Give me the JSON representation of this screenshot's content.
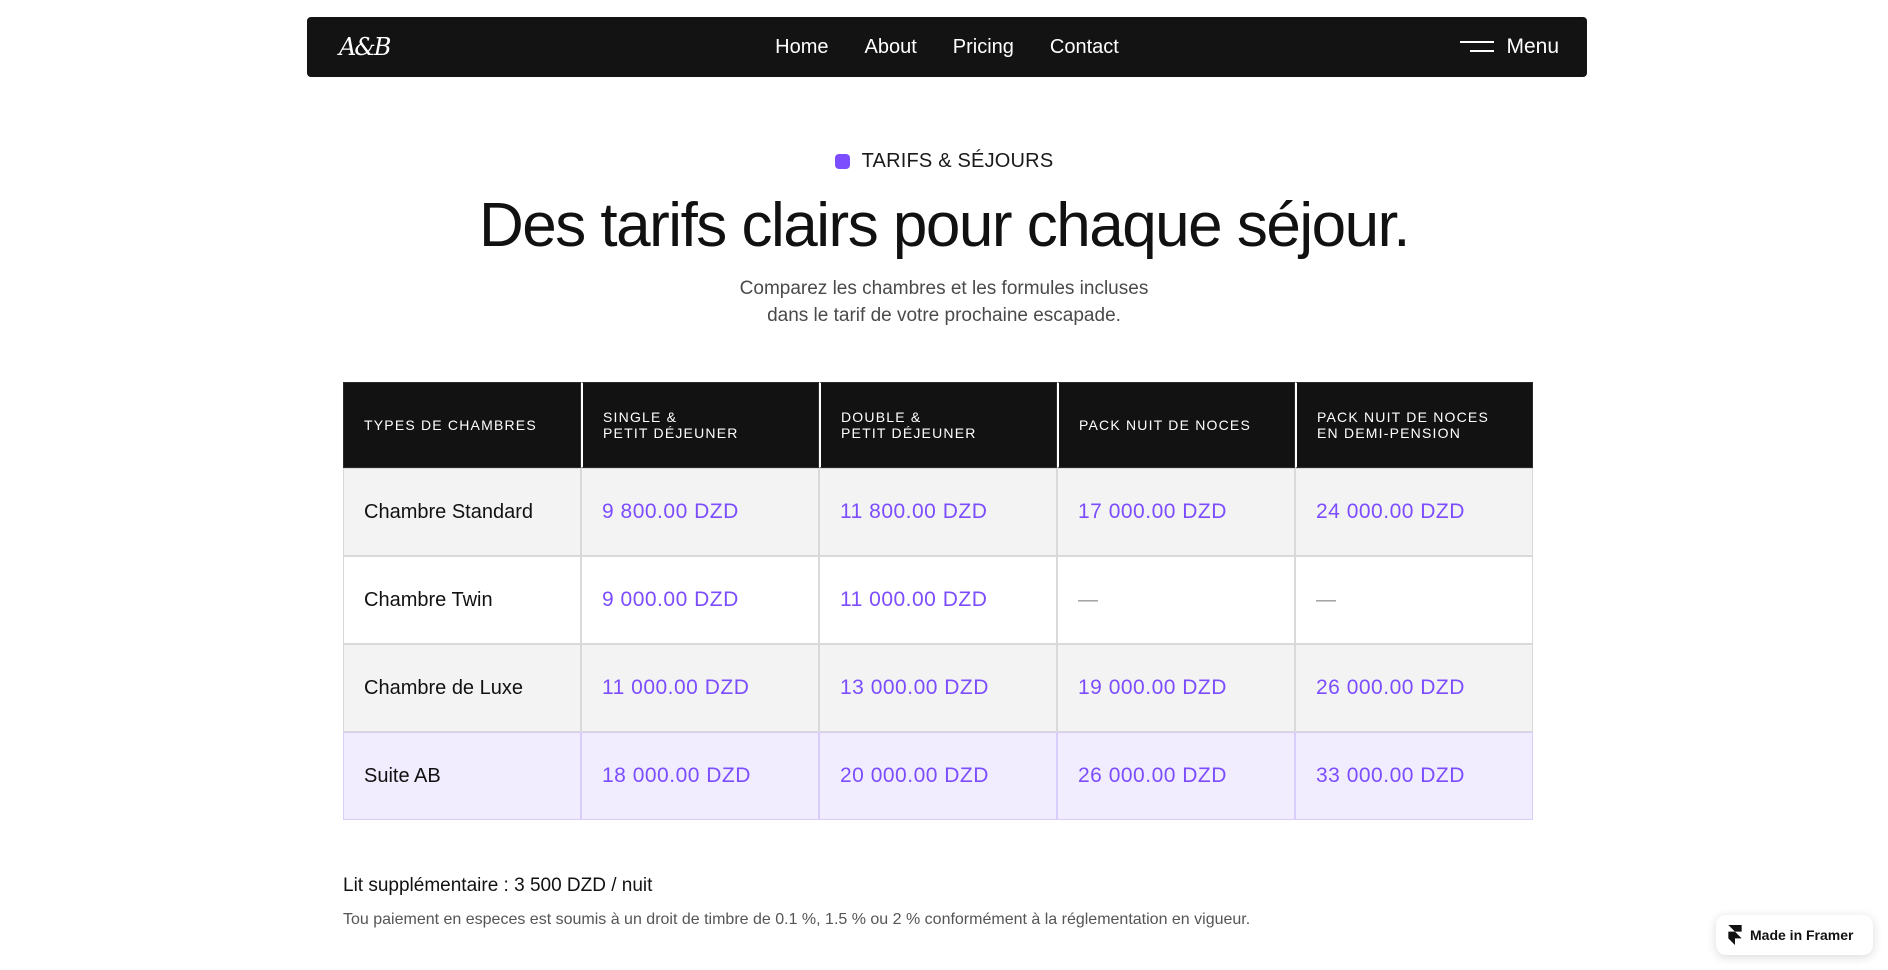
{
  "nav": {
    "logo": "A&B",
    "links": [
      "Home",
      "About",
      "Pricing",
      "Contact"
    ],
    "menu_label": "Menu"
  },
  "header": {
    "eyebrow": "TARIFS & SÉJOURS",
    "title": "Des tarifs clairs pour chaque séjour.",
    "subtitle_line1": "Comparez les chambres et les formules incluses",
    "subtitle_line2": "dans le tarif de votre prochaine escapade."
  },
  "colors": {
    "accent": "#7c4dff",
    "header_bg": "#121212",
    "highlight_row": "#f1edfe"
  },
  "pricing_table": {
    "columns": [
      {
        "line1": "TYPES DE CHAMBRES",
        "line2": ""
      },
      {
        "line1": "SINGLE &",
        "line2": "PETIT DÉJEUNER"
      },
      {
        "line1": "DOUBLE &",
        "line2": "PETIT DÉJEUNER"
      },
      {
        "line1": "PACK NUIT DE NOCES",
        "line2": ""
      },
      {
        "line1": "PACK NUIT DE NOCES",
        "line2": "EN DEMI-PENSION"
      }
    ],
    "rows": [
      {
        "room": "Chambre Standard",
        "single": "9 800.00 DZD",
        "double": "11 800.00 DZD",
        "noces": "17 000.00 DZD",
        "noces_dp": "24 000.00 DZD"
      },
      {
        "room": "Chambre Twin",
        "single": "9 000.00 DZD",
        "double": "11 000.00 DZD",
        "noces": "—",
        "noces_dp": "—"
      },
      {
        "room": "Chambre de Luxe",
        "single": "11 000.00 DZD",
        "double": "13 000.00 DZD",
        "noces": "19 000.00 DZD",
        "noces_dp": "26 000.00 DZD"
      },
      {
        "room": "Suite AB",
        "single": "18 000.00 DZD",
        "double": "20 000.00 DZD",
        "noces": "26 000.00 DZD",
        "noces_dp": "33 000.00 DZD"
      }
    ]
  },
  "notes": {
    "extra_bed": "Lit supplémentaire : 3 500 DZD / nuit",
    "tax": "Tou paiement en especes est soumis à un droit de timbre de 0.1 %, 1.5 % ou 2 % conformément à la réglementation en vigueur."
  },
  "badge": {
    "label": "Made in Framer"
  }
}
